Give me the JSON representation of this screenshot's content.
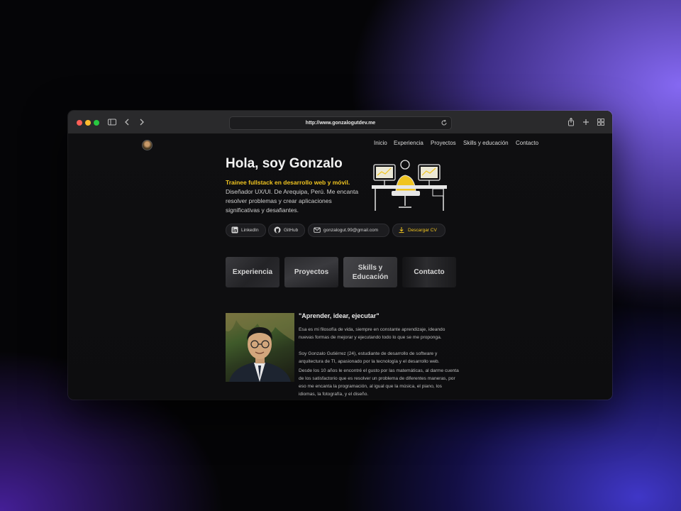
{
  "browser": {
    "url": "http://www.gonzalogutdev.me",
    "traffic_lights": {
      "close": "#ff5f57",
      "minimize": "#febc2e",
      "zoom": "#28c840"
    }
  },
  "site": {
    "nav": [
      "Inicio",
      "Experiencia",
      "Proyectos",
      "Skills y educación",
      "Contacto"
    ],
    "hero": {
      "title": "Hola, soy Gonzalo",
      "subtitle": "Trainee fullstack en desarrollo web y móvil.",
      "description": "Diseñador UX/UI. De Arequipa, Perú. Me encanta resolver problemas y crear aplicaciones significativas y desafiantes."
    },
    "links": [
      {
        "label": "LinkedIn",
        "icon": "linkedin-icon"
      },
      {
        "label": "GitHub",
        "icon": "github-icon"
      },
      {
        "label": "gonzalogut.99@gmail.com",
        "icon": "mail-icon"
      },
      {
        "label": "Descargar CV",
        "icon": "download-icon"
      }
    ],
    "sections": [
      "Experiencia",
      "Proyectos",
      "Skills y Educación",
      "Contacto"
    ],
    "about": {
      "title": "\"Aprender, idear, ejecutar\"",
      "paragraphs": [
        "Esa es mi filosofía de vida, siempre en constante aprendizaje, ideando nuevas formas de mejorar y ejecutando todo lo que se me proponga.",
        "Soy Gonzalo Gutiérrez (24), estudiante de desarrollo de software y arquitectura de TI, apasionado por la tecnología y el desarrollo web.",
        "Desde los 10 años le encontré el gusto por las matemáticas, al darme cuenta de los satisfactorio que es resolver un problema de diferentes maneras, por eso me encanta la programación, al igual que la música, el piano, los idiomas, la fotografía, y el diseño."
      ]
    },
    "accent_color": "#f0c420"
  }
}
